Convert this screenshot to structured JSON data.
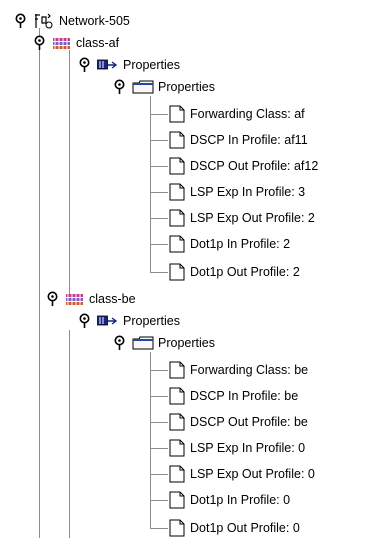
{
  "tree": {
    "root": {
      "label": "Network-505",
      "icon": "network-icon",
      "expanded": true
    },
    "classes": [
      {
        "label": "class-af",
        "icon": "class-icon",
        "expanded": true,
        "properties_group": {
          "label": "Properties",
          "icon": "properties-icon",
          "expanded": true,
          "folder": {
            "label": "Properties",
            "icon": "folder-icon",
            "expanded": true,
            "items": [
              {
                "label": "Forwarding Class: af",
                "icon": "document-icon"
              },
              {
                "label": "DSCP In Profile: af11",
                "icon": "document-icon"
              },
              {
                "label": "DSCP Out Profile: af12",
                "icon": "document-icon"
              },
              {
                "label": "LSP Exp In Profile: 3",
                "icon": "document-icon"
              },
              {
                "label": "LSP Exp Out Profile: 2",
                "icon": "document-icon"
              },
              {
                "label": "Dot1p In Profile: 2",
                "icon": "document-icon"
              },
              {
                "label": "Dot1p Out Profile: 2",
                "icon": "document-icon"
              }
            ]
          }
        }
      },
      {
        "label": "class-be",
        "icon": "class-icon",
        "expanded": true,
        "properties_group": {
          "label": "Properties",
          "icon": "properties-icon",
          "expanded": true,
          "folder": {
            "label": "Properties",
            "icon": "folder-icon",
            "expanded": true,
            "items": [
              {
                "label": "Forwarding Class: be",
                "icon": "document-icon"
              },
              {
                "label": "DSCP In Profile: be",
                "icon": "document-icon"
              },
              {
                "label": "DSCP Out Profile: be",
                "icon": "document-icon"
              },
              {
                "label": "LSP Exp In Profile: 0",
                "icon": "document-icon"
              },
              {
                "label": "LSP Exp Out Profile: 0",
                "icon": "document-icon"
              },
              {
                "label": "Dot1p In Profile: 0",
                "icon": "document-icon"
              },
              {
                "label": "Dot1p Out Profile: 0",
                "icon": "document-icon"
              }
            ]
          }
        }
      }
    ]
  }
}
